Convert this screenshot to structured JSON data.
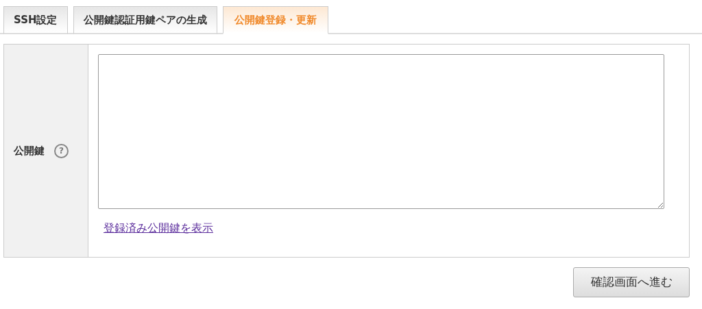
{
  "tabs": [
    {
      "label": "SSH設定",
      "selected": false
    },
    {
      "label": "公開鍵認証用鍵ペアの生成",
      "selected": false
    },
    {
      "label": "公開鍵登録・更新",
      "selected": true
    }
  ],
  "form": {
    "label": "公開鍵",
    "help": "?",
    "link": "登録済み公開鍵を表示"
  },
  "submit": "確認画面へ進む"
}
